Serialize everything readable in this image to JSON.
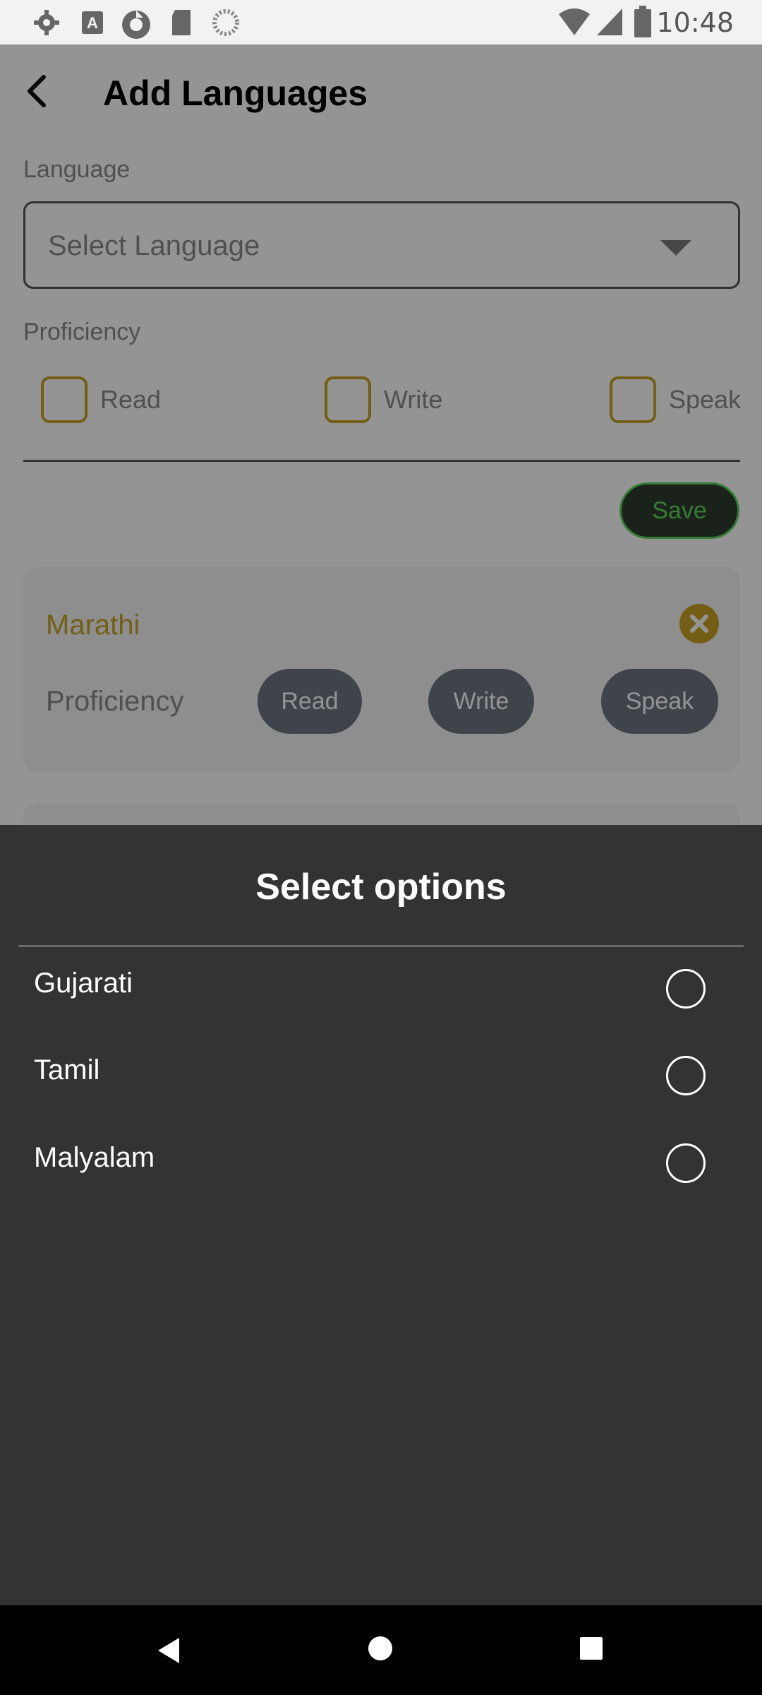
{
  "status_bar": {
    "time": "10:48",
    "left_icons": [
      "settings-icon",
      "font-a-icon",
      "sync-icon",
      "sd-card-icon",
      "circle-icon"
    ],
    "right_icons": [
      "wifi-icon",
      "signal-icon",
      "battery-icon"
    ]
  },
  "header": {
    "title": "Add Languages",
    "back_icon": "arrow-left-icon"
  },
  "form": {
    "language_label": "Language",
    "language_select": {
      "placeholder": "Select Language",
      "caret_icon": "caret-down-icon"
    },
    "proficiency_label": "Proficiency",
    "checkboxes": [
      {
        "label": "Read",
        "checked": false
      },
      {
        "label": "Write",
        "checked": false
      },
      {
        "label": "Speak",
        "checked": false
      }
    ],
    "save_label": "Save"
  },
  "language_cards": [
    {
      "name": "Marathi",
      "proficiency_label": "Proficiency",
      "chips": [
        "Read",
        "Write",
        "Speak"
      ],
      "remove_icon": "close-circle-icon"
    }
  ],
  "sheet": {
    "title": "Select options",
    "options": [
      {
        "label": "Gujarati",
        "selected": false
      },
      {
        "label": "Tamil",
        "selected": false
      },
      {
        "label": "Malyalam",
        "selected": false
      }
    ]
  },
  "nav_bar": {
    "buttons": [
      "back-nav-icon",
      "home-nav-icon",
      "recents-nav-icon"
    ]
  },
  "colors": {
    "accent": "#c9a227",
    "save_border": "#5cd65c",
    "chip_bg": "#6b7580",
    "sheet_bg": "#333333"
  }
}
